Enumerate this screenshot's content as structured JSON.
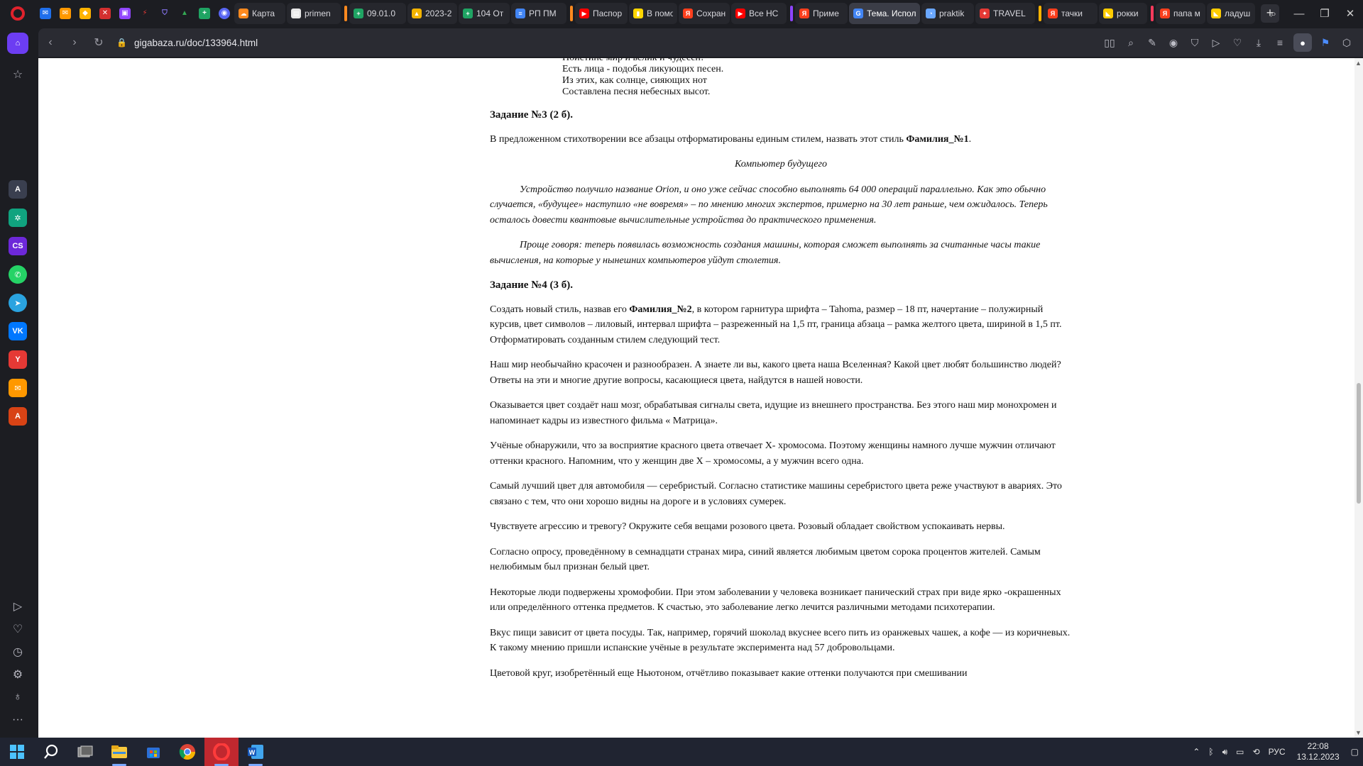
{
  "browser": {
    "tabs": [
      {
        "label": "Карта",
        "favicon": "cloud-icon",
        "color": "#ff8a1f"
      },
      {
        "label": "primen",
        "favicon": "doc-icon",
        "color": "#e8e8e8"
      },
      {
        "label": "09.01.0",
        "favicon": "sheets-icon",
        "color": "#1fa463"
      },
      {
        "label": "2023-2",
        "favicon": "drive-icon",
        "color": "#f4b400"
      },
      {
        "label": "104 От",
        "favicon": "sheets-icon",
        "color": "#1fa463"
      },
      {
        "label": "РП ПМ",
        "favicon": "docs-icon",
        "color": "#4285f4"
      },
      {
        "label": "Паспор",
        "favicon": "youtube-icon",
        "color": "#ff0000"
      },
      {
        "label": "В помо",
        "favicon": "bookmark-icon",
        "color": "#ffd600"
      },
      {
        "label": "Сохран",
        "favicon": "yandex-icon",
        "color": "#fc3f1d"
      },
      {
        "label": "Все НС",
        "favicon": "youtube-icon",
        "color": "#ff0000"
      },
      {
        "label": "Приме",
        "favicon": "yandex-icon",
        "color": "#fc3f1d"
      },
      {
        "label": "Тема. Испол",
        "favicon": "google-icon",
        "color": "#4285f4"
      },
      {
        "label": "praktik",
        "favicon": "page-icon",
        "color": "#6aa7ff"
      },
      {
        "label": "TRAVEL",
        "favicon": "travel-icon",
        "color": "#e53935"
      },
      {
        "label": "тачки",
        "favicon": "yandex-icon",
        "color": "#fc3f1d"
      },
      {
        "label": "рокки",
        "favicon": "images-icon",
        "color": "#ffcc00"
      },
      {
        "label": "папа м",
        "favicon": "yandex-icon",
        "color": "#fc3f1d"
      },
      {
        "label": "ладуш",
        "favicon": "images-icon",
        "color": "#ffcc00"
      }
    ],
    "url": "gigabaza.ru/doc/133964.html"
  },
  "document": {
    "verse": [
      "Поистине мир и велик и чудесен!",
      "Есть лица - подобья ликующих песен.",
      "Из этих, как солнце, сияющих нот",
      "Составлена песня небесных высот."
    ],
    "task3_heading": "Задание №3 (2 б).",
    "task3_text_a": "В предложенном стихотворении все абзацы отформатированы единым стилем, назвать этот стиль ",
    "task3_style": "Фамилия_№1",
    "task3_text_b": ".",
    "poem_title": "Компьютер будущего",
    "italic_p1": "Устройство получило название Orion, и оно уже сейчас способно выполнять 64 000 операций параллельно. Как это обычно случается, «будущее» наступило «не вовремя» – по мнению многих экспертов, примерно на 30 лет раньше, чем ожидалось. Теперь осталось довести квантовые вычислительные устройства до практического применения.",
    "italic_p2": "Проще говоря: теперь появилась возможность создания машины, которая сможет выполнять за считанные часы такие вычисления, на которые у нынешних компьютеров уйдут столетия.",
    "task4_heading": "Задание №4 (3 б).",
    "task4_text_a": "Создать новый стиль, назвав его ",
    "task4_style": "Фамилия_№2",
    "task4_text_b": ", в котором гарнитура шрифта – Tahoma, размер – 18 пт, начертание – полужирный курсив, цвет символов – лиловый, интервал шрифта – разреженный на 1,5 пт, граница абзаца – рамка желтого цвета, шириной в 1,5 пт. Отформатировать созданным стилем следующий тест.",
    "paragraphs": [
      "Наш мир необычайно красочен и разнообразен. А знаете ли вы, какого цвета наша Вселенная? Какой цвет любят большинство людей? Ответы на эти и многие другие вопросы, касающиеся цвета, найдутся в нашей новости.",
      "Оказывается цвет создаёт наш мозг, обрабатывая сигналы света, идущие из внешнего пространства. Без этого наш мир монохромен и напоминает кадры из известного фильма « Матрица».",
      "Учёные обнаружили, что за восприятие красного цвета отвечает Х- хромосома. Поэтому женщины намного лучше мужчин отличают оттенки красного. Напомним, что у женщин две Х – хромосомы, а у мужчин всего одна.",
      "Самый лучший цвет для автомобиля — серебристый. Согласно статистике машины серебристого цвета реже участвуют в авариях. Это связано с тем, что они хорошо видны на дороге и в условиях сумерек.",
      "Чувствуете агрессию и тревогу? Окружите себя вещами розового цвета. Розовый обладает свойством успокаивать нервы.",
      "Согласно опросу, проведённому в семнадцати странах мира, синий является любимым цветом сорока процентов жителей. Самым нелюбимым был признан белый цвет.",
      "Некоторые люди подвержены хромофобии. При этом заболевании у человека возникает панический страх при виде ярко -окрашенных или определённого оттенка предметов. К счастью, это заболевание легко лечится различными методами психотерапии.",
      "Вкус пищи зависит от цвета посуды. Так, например, горячий шоколад вкуснее всего пить из оранжевых чашек, а кофе — из коричневых. К такому мнению пришли испанские учёные в результате эксперимента над 57 добровольцами.",
      "Цветовой круг, изобретённый еще Ньютоном, отчётливо показывает какие оттенки получаются при смешивании"
    ]
  },
  "taskbar": {
    "language": "РУС",
    "time": "22:08",
    "date": "13.12.2023"
  },
  "colors": {
    "accent": "#6c3df2",
    "opera_red": "#e0222c"
  }
}
